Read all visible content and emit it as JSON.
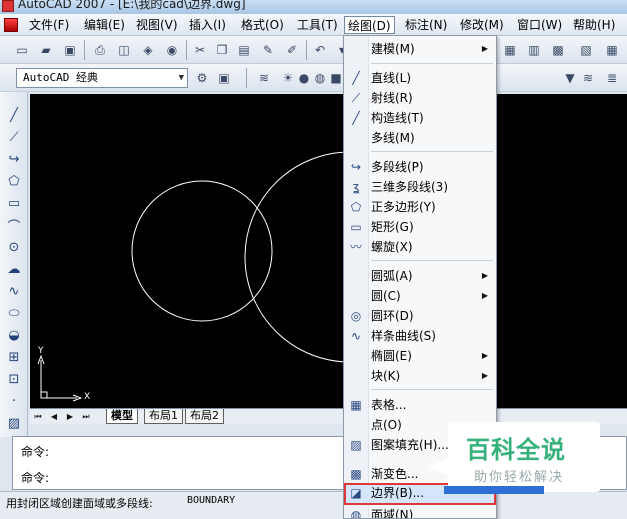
{
  "window": {
    "title": "AutoCAD 2007 - [E:\\我的cad\\边界.dwg]"
  },
  "menubar": [
    {
      "label": "文件(F)",
      "active": false
    },
    {
      "label": "编辑(E)",
      "active": false
    },
    {
      "label": "视图(V)",
      "active": false
    },
    {
      "label": "插入(I)",
      "active": false
    },
    {
      "label": "格式(O)",
      "active": false
    },
    {
      "label": "工具(T)",
      "active": false
    },
    {
      "label": "绘图(D)",
      "active": true
    },
    {
      "label": "标注(N)",
      "active": false
    },
    {
      "label": "修改(M)",
      "active": false
    },
    {
      "label": "窗口(W)",
      "active": false
    },
    {
      "label": "帮助(H)",
      "active": false
    }
  ],
  "toolbar": {
    "workspace_value": "AutoCAD 经典"
  },
  "draw_menu": {
    "items": [
      {
        "label": "建模(M)",
        "icon": "none",
        "submenu": true
      },
      {
        "label": "直线(L)",
        "icon": "line-icon",
        "submenu": false
      },
      {
        "label": "射线(R)",
        "icon": "ray-icon",
        "submenu": false
      },
      {
        "label": "构造线(T)",
        "icon": "xline-icon",
        "submenu": false
      },
      {
        "label": "多线(M)",
        "icon": "none",
        "submenu": false
      },
      {
        "label": "多段线(P)",
        "icon": "polyline-icon",
        "submenu": false
      },
      {
        "label": "三维多段线(3)",
        "icon": "3dpolyline-icon",
        "submenu": false
      },
      {
        "label": "正多边形(Y)",
        "icon": "polygon-icon",
        "submenu": false
      },
      {
        "label": "矩形(G)",
        "icon": "rectangle-icon",
        "submenu": false
      },
      {
        "label": "螺旋(X)",
        "icon": "helix-icon",
        "submenu": false
      },
      {
        "label": "圆弧(A)",
        "icon": "none",
        "submenu": true
      },
      {
        "label": "圆(C)",
        "icon": "none",
        "submenu": true
      },
      {
        "label": "圆环(D)",
        "icon": "donut-icon",
        "submenu": false
      },
      {
        "label": "样条曲线(S)",
        "icon": "spline-icon",
        "submenu": false
      },
      {
        "label": "椭圆(E)",
        "icon": "none",
        "submenu": true
      },
      {
        "label": "块(K)",
        "icon": "none",
        "submenu": true
      },
      {
        "label": "表格...",
        "icon": "table-icon",
        "submenu": false
      },
      {
        "label": "点(O)",
        "icon": "none",
        "submenu": true
      },
      {
        "label": "图案填充(H)...",
        "icon": "hatch-icon",
        "submenu": false
      },
      {
        "label": "渐变色...",
        "icon": "gradient-icon",
        "submenu": false
      },
      {
        "label": "边界(B)...",
        "icon": "boundary-icon",
        "submenu": false,
        "highlighted": true
      },
      {
        "label": "面域(N)",
        "icon": "region-icon",
        "submenu": false
      }
    ]
  },
  "canvas": {
    "ucs_x": "X",
    "ucs_y": "Y"
  },
  "tabs": [
    "模型",
    "布局1",
    "布局2"
  ],
  "command": {
    "line1": "命令:",
    "line2": "命令:"
  },
  "status": {
    "prompt": "用封闭区域创建面域或多段线:",
    "command": "BOUNDARY"
  },
  "watermark": {
    "main": "百科全说",
    "sub": "助你轻松解决"
  },
  "colors": {
    "highlight_border": "#e0373a",
    "watermark_green": "#36b17a",
    "canvas_bg": "#000000"
  }
}
